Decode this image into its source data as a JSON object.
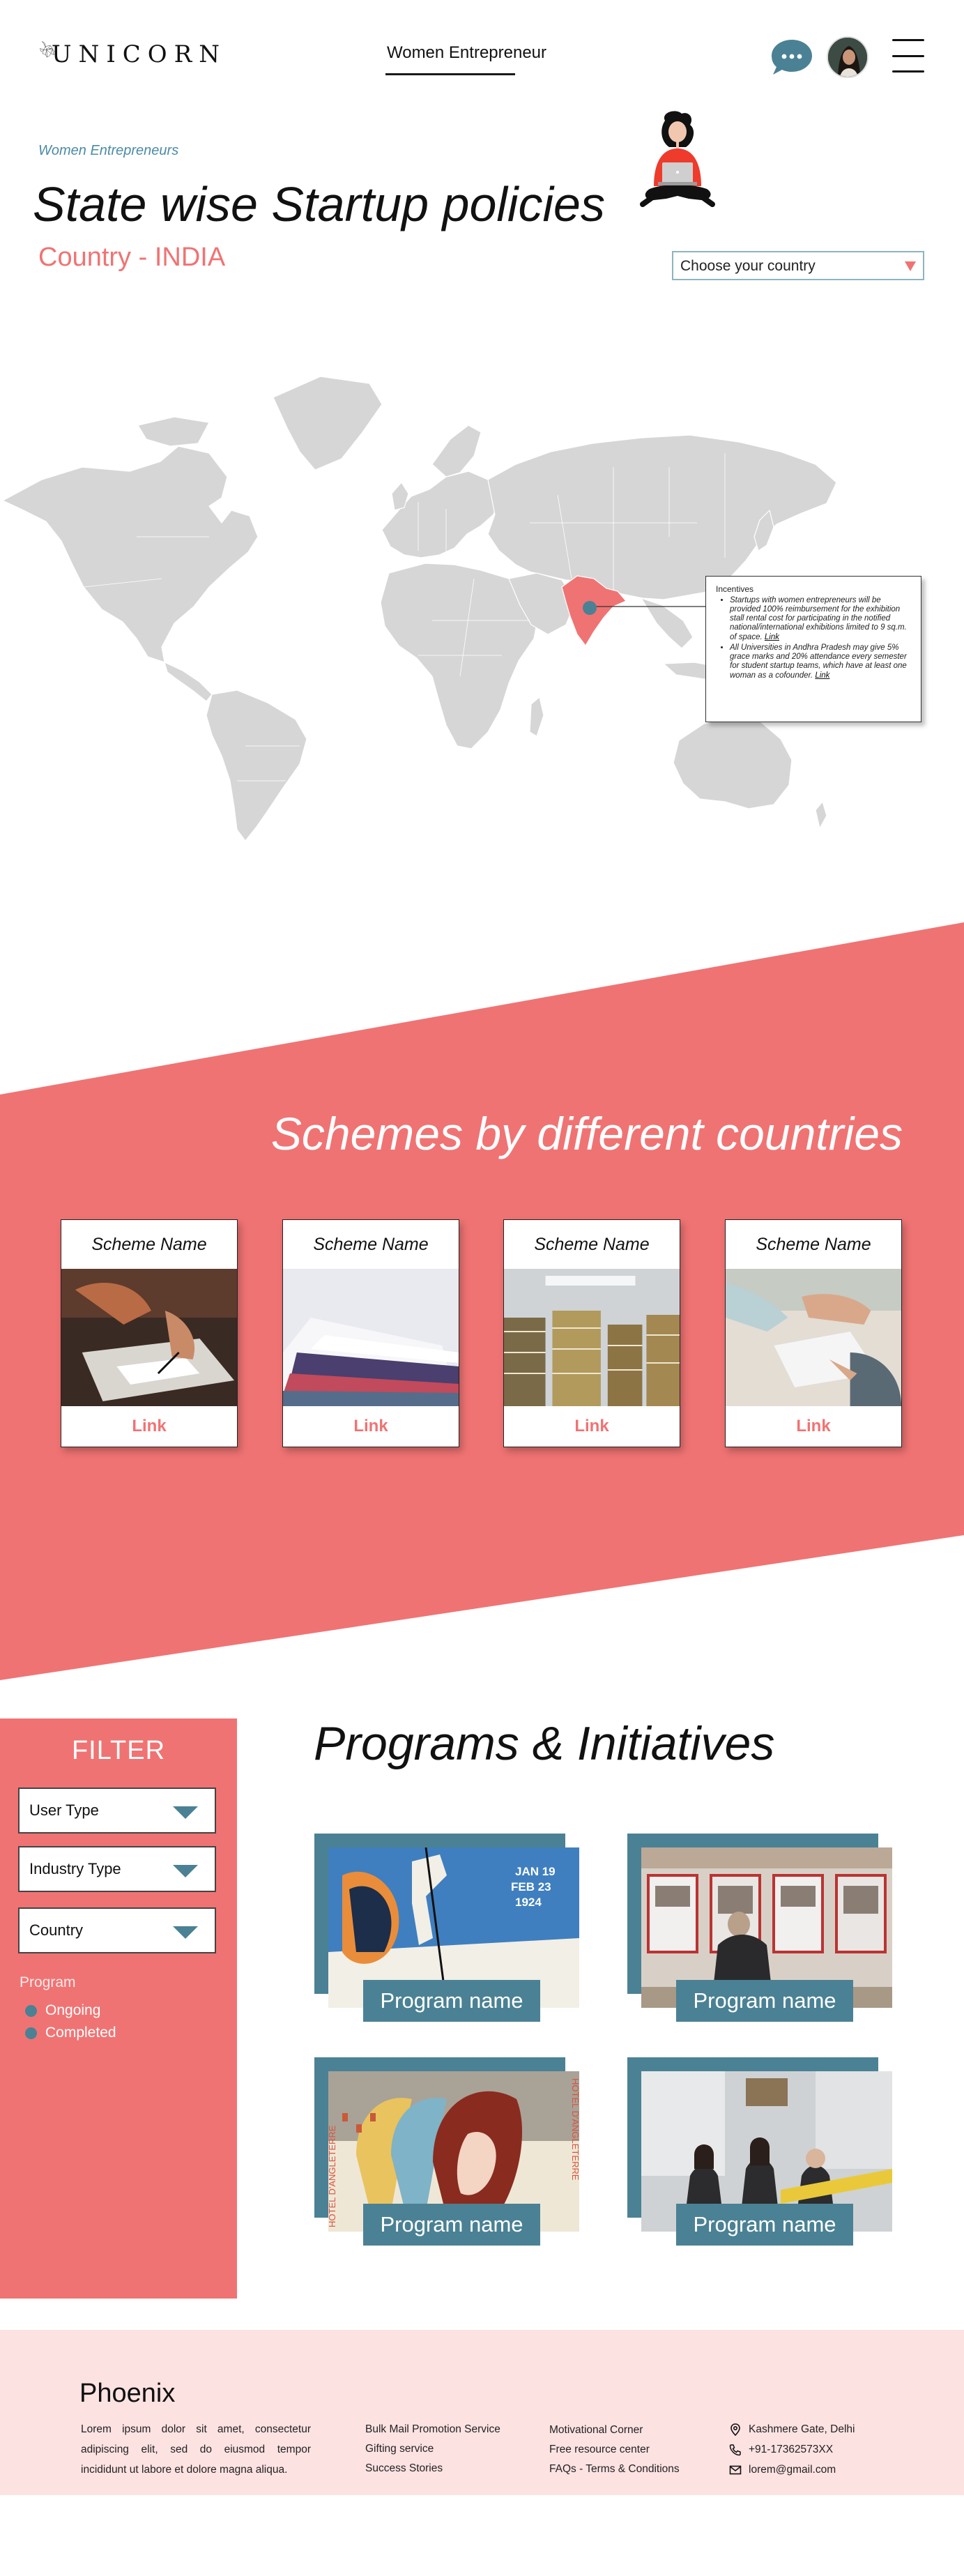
{
  "brand": {
    "logo_text": "UNICORN"
  },
  "header": {
    "nav_link": "Women Entrepreneur"
  },
  "hero": {
    "eyebrow": "Women Entrepreneurs",
    "title": "State wise Startup policies",
    "country_label": "Country - INDIA",
    "country_select": "Choose your country"
  },
  "map": {
    "highlight_color": "#f07373",
    "marker_color": "#4b8194",
    "tooltip": {
      "heading": "Incentives",
      "items": [
        {
          "text": "Startups with women entrepreneurs will be provided 100% reimbursement for the exhibition stall rental cost for participating in the notified national/international exhibitions limited to 9 sq.m. of space.",
          "link": "Link"
        },
        {
          "text": "All Universities in Andhra Pradesh may give 5% grace marks and 20% attendance every semester for student startup teams, which have at least one woman as a cofounder.",
          "link": "Link"
        }
      ]
    }
  },
  "schemes": {
    "title": "Schemes by different countries",
    "cards": [
      {
        "name": "Scheme Name",
        "link": "Link"
      },
      {
        "name": "Scheme Name",
        "link": "Link"
      },
      {
        "name": "Scheme Name",
        "link": "Link"
      },
      {
        "name": "Scheme Name",
        "link": "Link"
      }
    ]
  },
  "filter": {
    "title": "FILTER",
    "dropdowns": [
      "User Type",
      "Industry Type",
      "Country"
    ],
    "program_label": "Program",
    "options": [
      "Ongoing",
      "Completed"
    ]
  },
  "programs": {
    "title": "Programs & Initiatives",
    "cards": [
      {
        "label": "Program name",
        "poster_text": [
          "JAN 19",
          "FEB 23",
          "1924"
        ]
      },
      {
        "label": "Program name"
      },
      {
        "label": "Program name",
        "poster_text": [
          "HOTEL D'ANGLETERRE",
          "HOTEL D'ANGLETERRE"
        ]
      },
      {
        "label": "Program name"
      }
    ]
  },
  "footer": {
    "brand": "Phoenix",
    "lorem": "Lorem ipsum dolor sit amet, consectetur adipiscing elit, sed do eiusmod tempor incididunt ut labore et dolore magna aliqua.",
    "col1": [
      "Bulk Mail Promotion Service",
      "Gifting service",
      "Success Stories"
    ],
    "col2": [
      "Motivational Corner",
      "Free resource center",
      "FAQs - Terms & Conditions"
    ],
    "contact": {
      "address": "Kashmere Gate, Delhi",
      "phone": "+91-17362573XX",
      "email": "lorem@gmail.com"
    }
  },
  "colors": {
    "accent": "#f07373",
    "teal": "#4b8194",
    "footer_bg": "#fde2e2",
    "map_land": "#d6d6d6"
  }
}
